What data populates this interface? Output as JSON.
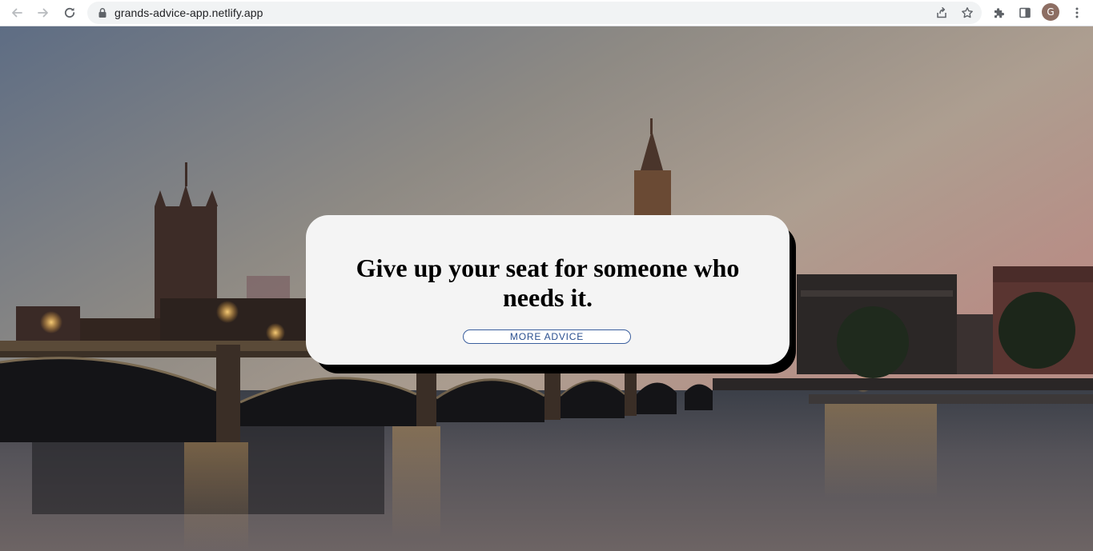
{
  "browser": {
    "url": "grands-advice-app.netlify.app",
    "profile_initial": "G",
    "icons": {
      "back": "back-arrow-icon",
      "forward": "forward-arrow-icon",
      "reload": "reload-icon",
      "lock": "lock-icon",
      "share": "share-icon",
      "bookmark": "star-icon",
      "extensions": "puzzle-icon",
      "side_panel": "side-panel-icon",
      "menu": "kebab-menu-icon"
    }
  },
  "advice_card": {
    "text": "Give up your seat for someone who needs it.",
    "button_label": "MORE ADVICE"
  },
  "colors": {
    "card_background": "#f4f4f4",
    "card_shadow": "#000000",
    "button_border": "#3b5f9e",
    "button_text": "#2a4f8f"
  }
}
